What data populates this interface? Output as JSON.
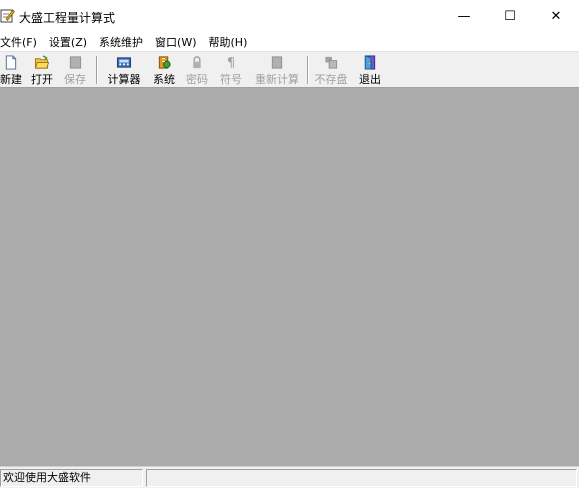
{
  "window": {
    "title": "大盛工程量计算式",
    "minimize_glyph": "—",
    "maximize_glyph": "☐",
    "close_glyph": "✕"
  },
  "menu": [
    {
      "label": "文件(F)"
    },
    {
      "label": "设置(Z)"
    },
    {
      "label": "系统维护"
    },
    {
      "label": "窗口(W)"
    },
    {
      "label": "帮助(H)"
    }
  ],
  "toolbar": {
    "new_label": "新建",
    "open_label": "打开",
    "save_label": "保存",
    "calculator_label": "计算器",
    "system_label": "系统",
    "password_label": "密码",
    "symbol_label": "符号",
    "recalculate_label": "重新计算",
    "no_save_label": "不存盘",
    "exit_label": "退出"
  },
  "status": {
    "message": "欢迎使用大盛软件",
    "secondary": ""
  }
}
